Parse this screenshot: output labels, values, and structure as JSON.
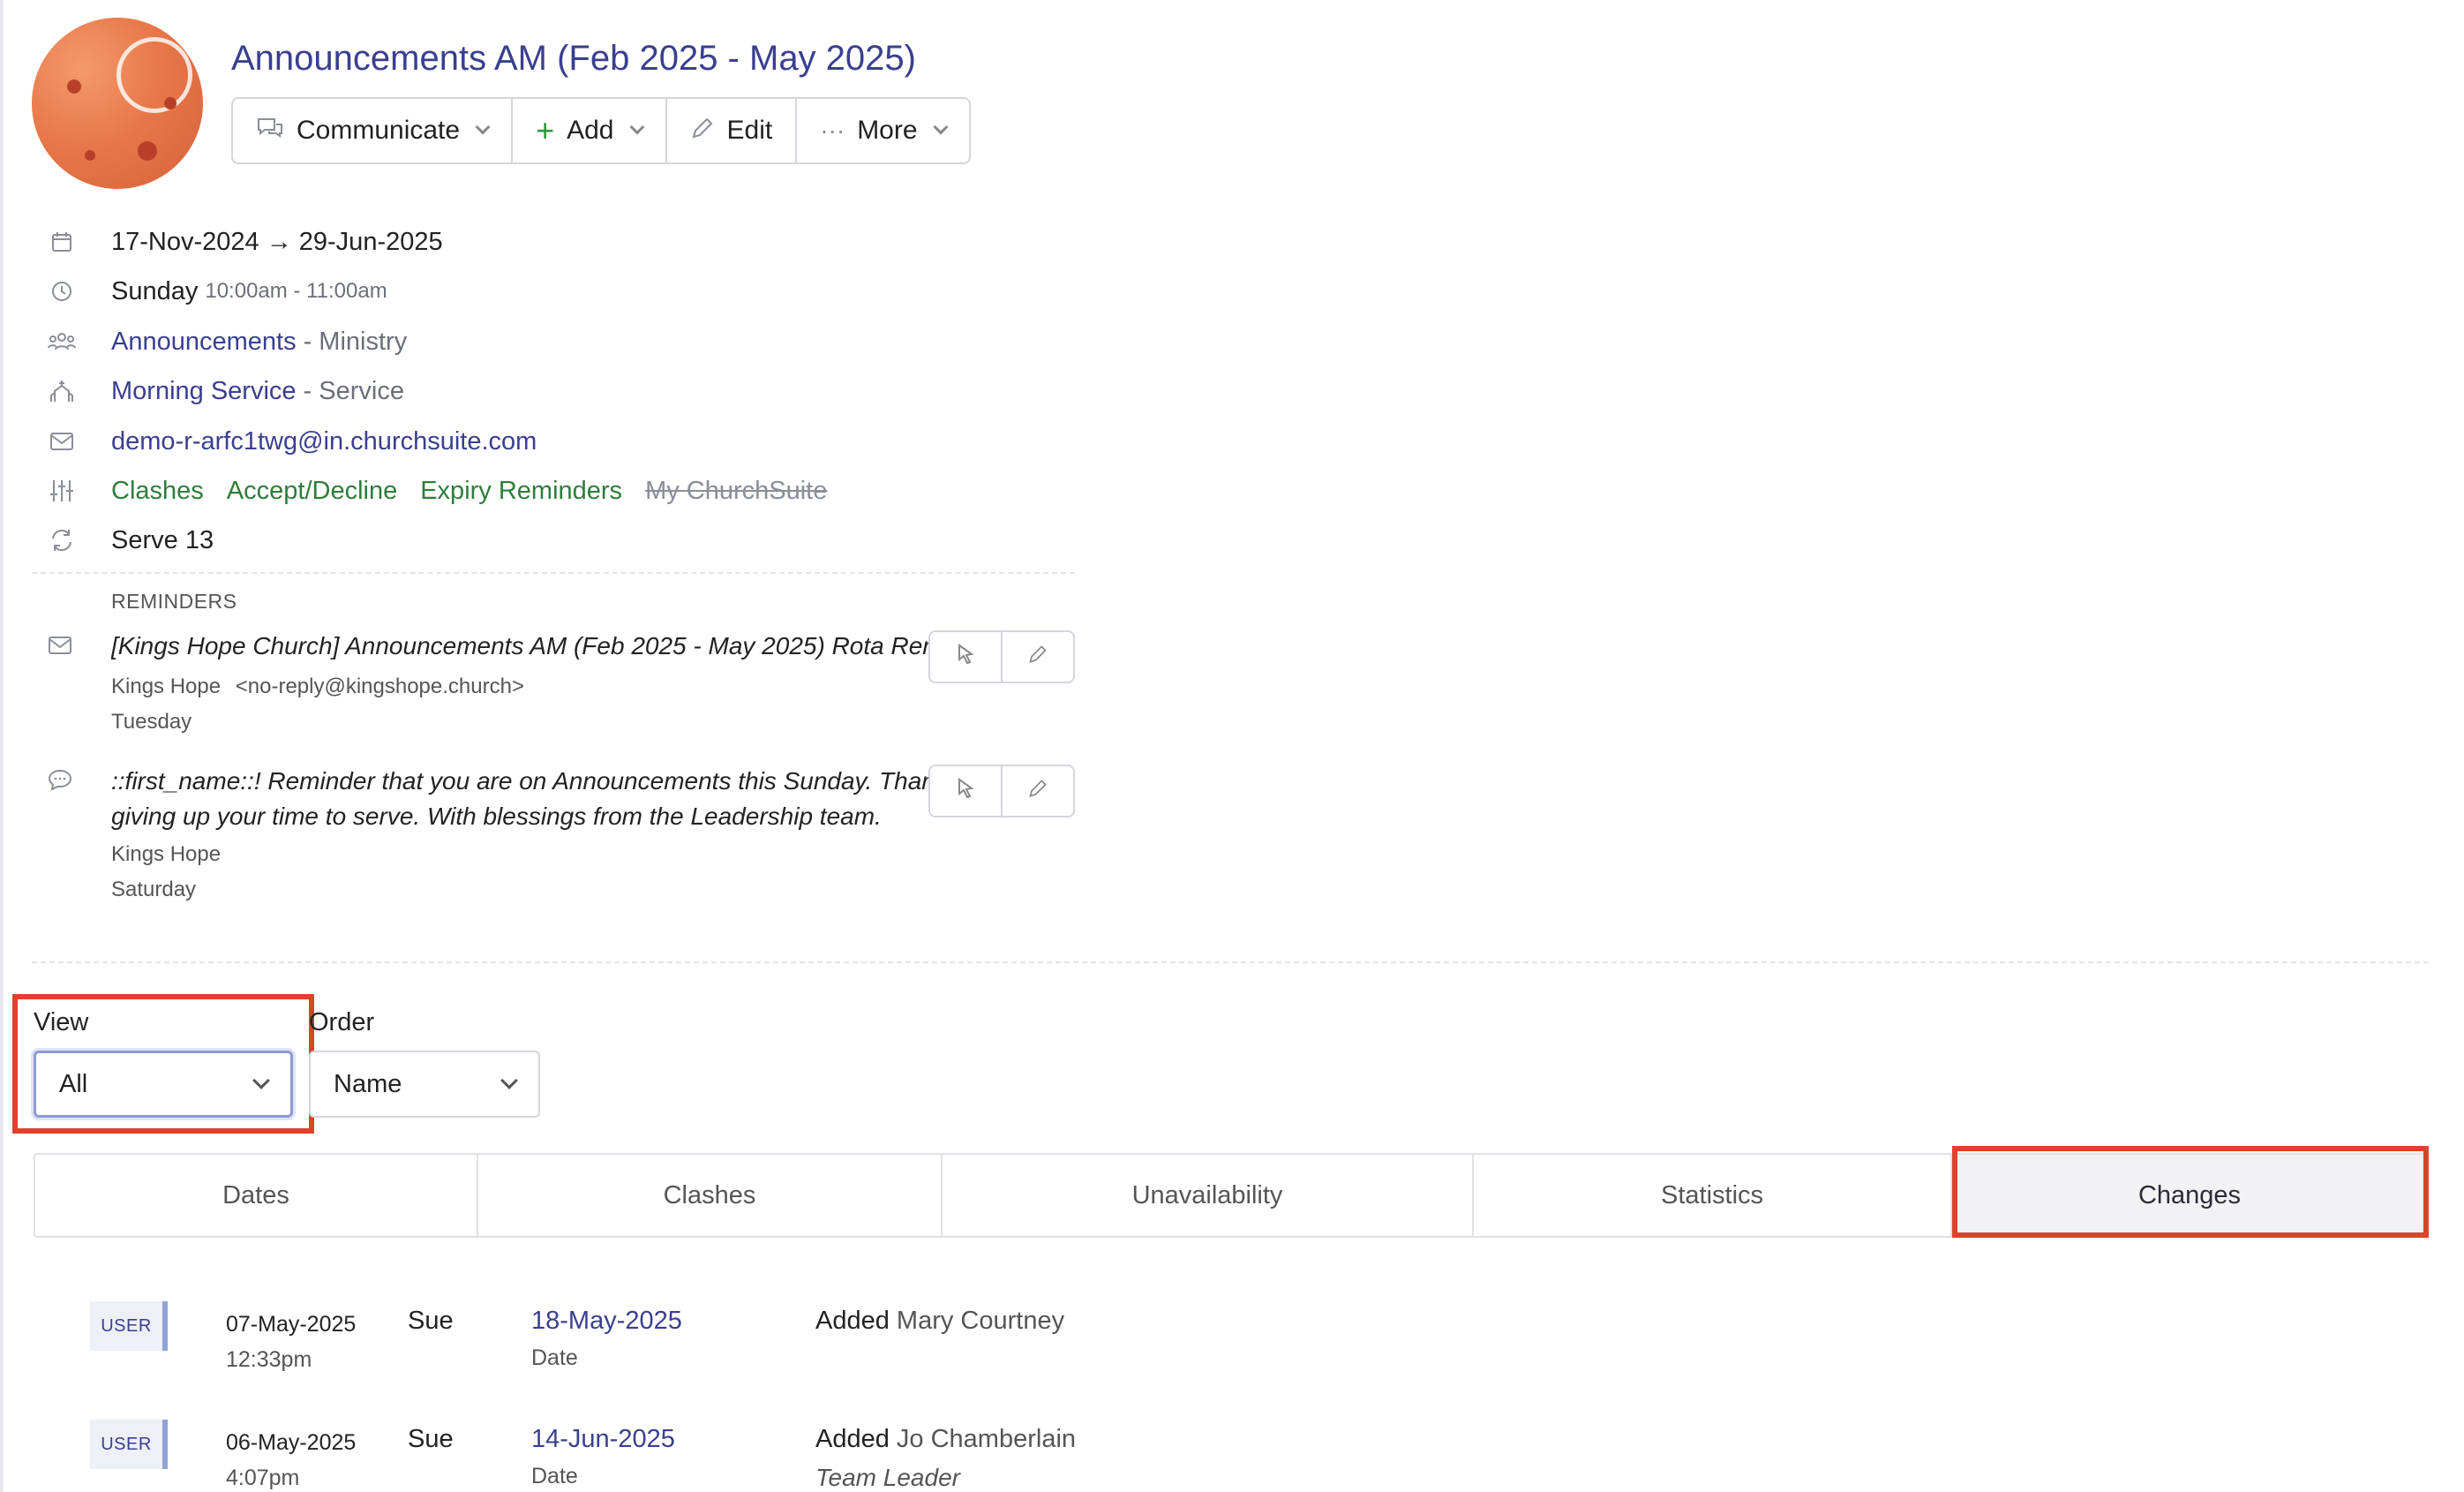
{
  "header": {
    "title": "Announcements AM (Feb 2025 - May 2025)",
    "buttons": {
      "communicate": "Communicate",
      "add": "Add",
      "edit": "Edit",
      "more": "More"
    }
  },
  "details": {
    "date_range": "17-Nov-2024 → 29-Jun-2025",
    "day": "Sunday",
    "time": "10:00am - 11:00am",
    "ministry_name": "Announcements",
    "ministry_type": "- Ministry",
    "service_name": "Morning Service",
    "service_type": "- Service",
    "email": "demo-r-arfc1twg@in.churchsuite.com",
    "settings": {
      "clashes": "Clashes",
      "accept_decline": "Accept/Decline",
      "expiry_reminders": "Expiry Reminders",
      "my_churchsuite": "My ChurchSuite"
    },
    "serve": "Serve 13"
  },
  "reminders": {
    "heading": "REMINDERS",
    "email_reminder": {
      "text": "[Kings Hope Church] Announcements AM (Feb 2025 - May 2025) Rota Reminder",
      "from_name": "Kings Hope",
      "from_email": "<no-reply@kingshope.church>",
      "day": "Tuesday"
    },
    "sms_reminder": {
      "line1": "::first_name::! Reminder that you are on Announcements this Sunday. Thank you for",
      "line2": "giving up your time to serve. With blessings from the Leadership team.",
      "from_name": "Kings Hope",
      "day": "Saturday"
    }
  },
  "filters": {
    "view_label": "View",
    "view_value": "All",
    "order_label": "Order",
    "order_value": "Name"
  },
  "tabs": [
    "Dates",
    "Clashes",
    "Unavailability",
    "Statistics",
    "Changes"
  ],
  "active_tab": "Changes",
  "changes": [
    {
      "badge": "USER",
      "date": "07-May-2025",
      "time": "12:33pm",
      "who": "Sue",
      "target": "18-May-2025",
      "target_type": "Date",
      "action": "Added",
      "name": "Mary Courtney",
      "role": ""
    },
    {
      "badge": "USER",
      "date": "06-May-2025",
      "time": "4:07pm",
      "who": "Sue",
      "target": "14-Jun-2025",
      "target_type": "Date",
      "action": "Added",
      "name": "Jo Chamberlain",
      "role": "Team Leader"
    }
  ],
  "colors": {
    "title": "#3a3f8f",
    "link": "#3a3f8f",
    "green_setting": "#2e7d3b",
    "highlight": "#e0412c",
    "badge_border": "#8fa3d6"
  }
}
